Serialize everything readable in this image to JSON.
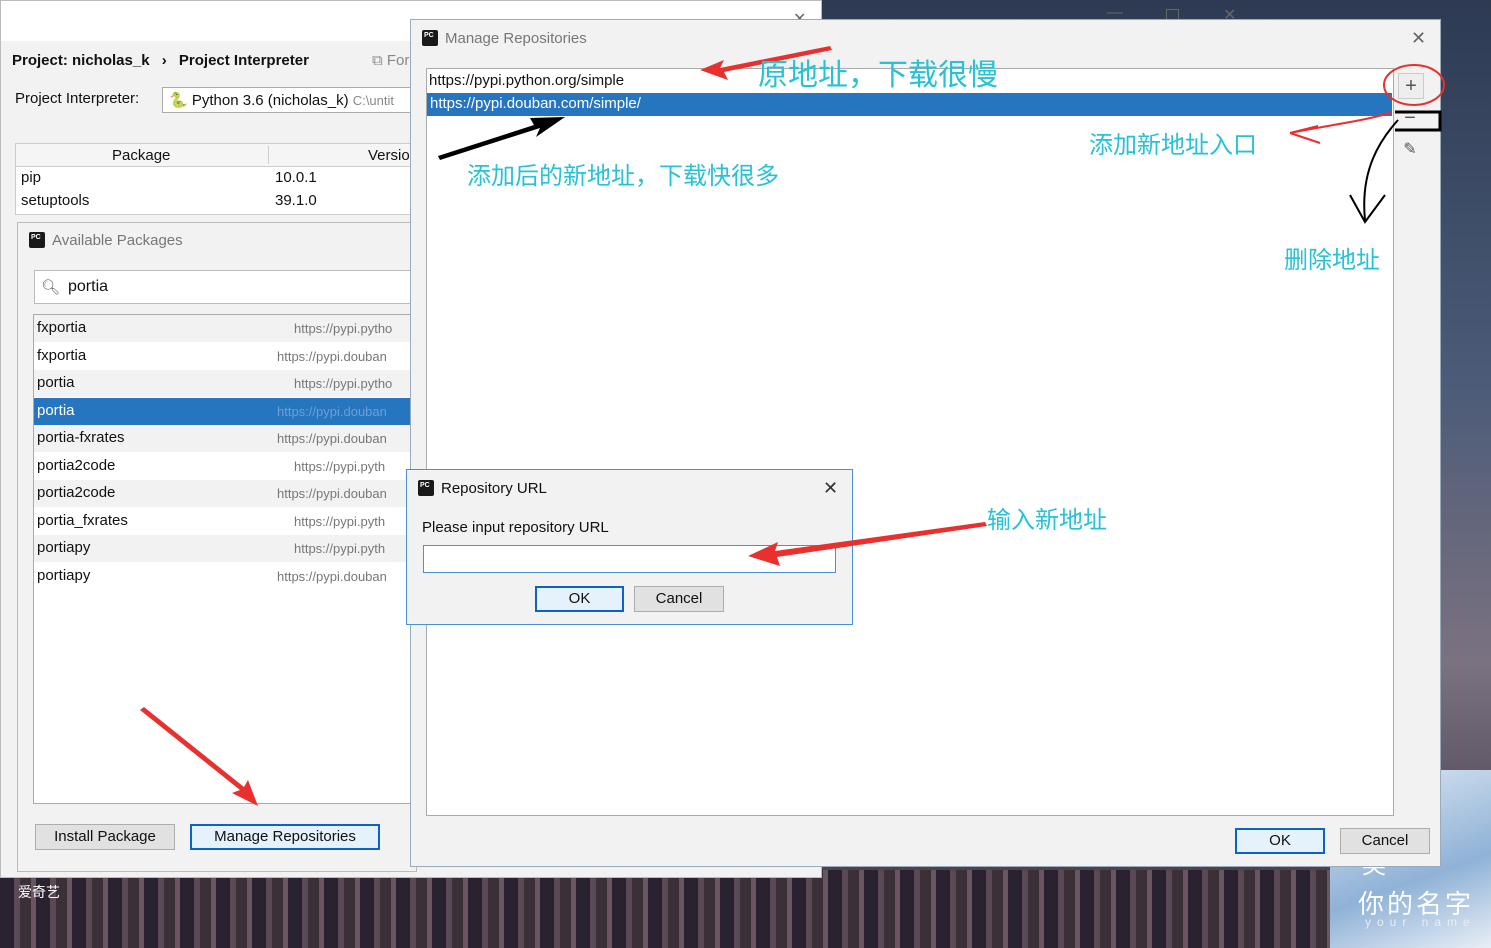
{
  "settings": {
    "breadcrumb": [
      "Project: nicholas_k",
      "›",
      "Project Interpreter"
    ],
    "for_label": "For",
    "interpreter_label": "Project Interpreter:",
    "interpreter_value": "Python 3.6 (nicholas_k)",
    "interpreter_path": "C:\\untit",
    "columns": [
      "Package",
      "Versio"
    ],
    "packages": [
      {
        "name": "pip",
        "version": "10.0.1"
      },
      {
        "name": "setuptools",
        "version": "39.1.0"
      }
    ]
  },
  "available": {
    "title": "Available Packages",
    "search": "portia",
    "items": [
      {
        "name": "fxportia",
        "url": "https://pypi.pytho"
      },
      {
        "name": "fxportia",
        "url": "https://pypi.douban"
      },
      {
        "name": "portia",
        "url": "https://pypi.pytho"
      },
      {
        "name": "portia",
        "url": "https://pypi.douban"
      },
      {
        "name": "portia-fxrates",
        "url": "https://pypi.douban"
      },
      {
        "name": "portia2code",
        "url": "https://pypi.pyth"
      },
      {
        "name": "portia2code",
        "url": "https://pypi.douban"
      },
      {
        "name": "portia_fxrates",
        "url": "https://pypi.pyth"
      },
      {
        "name": "portiapy",
        "url": "https://pypi.pyth"
      },
      {
        "name": "portiapy",
        "url": "https://pypi.douban"
      }
    ],
    "selected_index": 3,
    "install_button": "Install Package",
    "manage_button": "Manage Repositories"
  },
  "manage": {
    "title": "Manage Repositories",
    "repos": [
      "https://pypi.python.org/simple",
      "https://pypi.douban.com/simple/"
    ],
    "ok": "OK",
    "cancel": "Cancel"
  },
  "repo_url_dialog": {
    "title": "Repository URL",
    "prompt": "Please input repository URL",
    "value": "",
    "ok": "OK",
    "cancel": "Cancel"
  },
  "annotations": {
    "original": "原地址，下载很慢",
    "added": "添加后的新地址，下载快很多",
    "add_entry": "添加新地址入口",
    "delete": "删除地址",
    "input_new": "输入新地址"
  },
  "wallpaper": {
    "watermark": "爱奇艺",
    "poster_line1": "英",
    "poster_line2": "你的名字",
    "poster_line3": "your name"
  },
  "colors": {
    "selection": "#2675bf",
    "annotation": "#26c2d6",
    "arrow": "#e8312f"
  }
}
